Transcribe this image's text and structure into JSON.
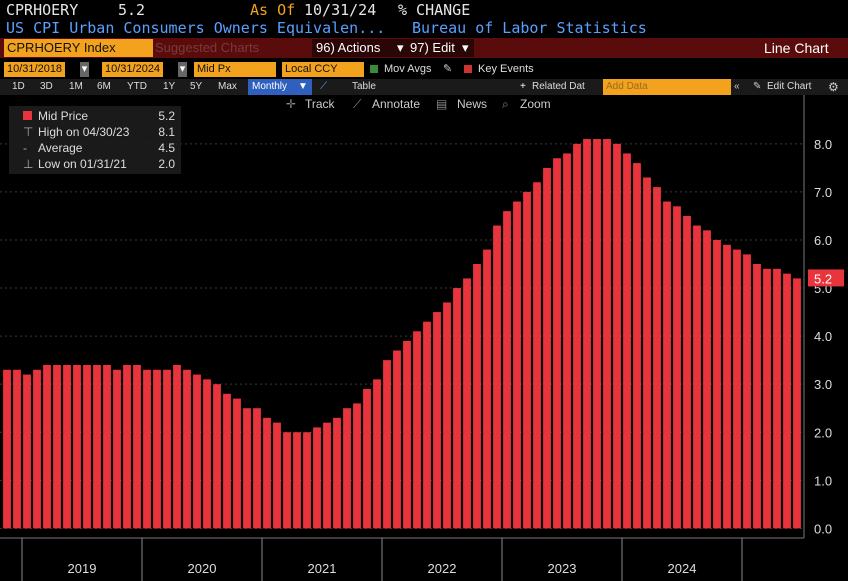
{
  "header": {
    "ticker": "CPRHOERY",
    "last_value": "5.2",
    "as_of_label": "As Of",
    "as_of_date": "10/31/24",
    "change_label": "% CHANGE",
    "description": "US CPI Urban Consumers Owners Equivalen...",
    "source": "Bureau of Labor Statistics"
  },
  "toolbar": {
    "security": "CPRHOERY Index",
    "suggested_charts": "Suggested Charts",
    "actions": "96) Actions",
    "edit": "97) Edit",
    "chart_type": "Line Chart"
  },
  "controls": {
    "start_date": "10/31/2018",
    "end_date": "10/31/2024",
    "price_field": "Mid Px",
    "currency": "Local CCY",
    "mov_avgs": "Mov Avgs",
    "key_events": "Key Events"
  },
  "periods": [
    "1D",
    "3D",
    "1M",
    "6M",
    "YTD",
    "1Y",
    "5Y",
    "Max"
  ],
  "frequency": "Monthly",
  "table_label": "Table",
  "related_data": "Related Dat",
  "add_data_placeholder": "Add Data",
  "edit_chart": "Edit Chart",
  "chart_tools": {
    "track": "Track",
    "annotate": "Annotate",
    "news": "News",
    "zoom": "Zoom"
  },
  "legend": {
    "mid_price_label": "Mid Price",
    "mid_price_value": "5.2",
    "high_label": "High on 04/30/23",
    "high_value": "8.1",
    "average_label": "Average",
    "average_value": "4.5",
    "low_label": "Low on 01/31/21",
    "low_value": "2.0"
  },
  "chart_data": {
    "type": "bar",
    "series": [
      {
        "name": "Mid Price",
        "color": "#e8343c",
        "values": [
          3.3,
          3.3,
          3.2,
          3.3,
          3.4,
          3.4,
          3.4,
          3.4,
          3.4,
          3.4,
          3.4,
          3.3,
          3.4,
          3.4,
          3.3,
          3.3,
          3.3,
          3.4,
          3.3,
          3.2,
          3.1,
          3.0,
          2.8,
          2.7,
          2.5,
          2.5,
          2.3,
          2.2,
          2.0,
          2.0,
          2.0,
          2.1,
          2.2,
          2.3,
          2.5,
          2.6,
          2.9,
          3.1,
          3.5,
          3.7,
          3.9,
          4.1,
          4.3,
          4.5,
          4.7,
          5.0,
          5.2,
          5.5,
          5.8,
          6.3,
          6.6,
          6.8,
          7.0,
          7.2,
          7.5,
          7.7,
          7.8,
          8.0,
          8.1,
          8.1,
          8.1,
          8.0,
          7.8,
          7.6,
          7.3,
          7.1,
          6.8,
          6.7,
          6.5,
          6.3,
          6.2,
          6.0,
          5.9,
          5.8,
          5.7,
          5.5,
          5.4,
          5.4,
          5.3,
          5.2
        ]
      }
    ],
    "x_labels": [
      "2019",
      "2020",
      "2021",
      "2022",
      "2023",
      "2024"
    ],
    "y_ticks": [
      0.0,
      1.0,
      2.0,
      3.0,
      4.0,
      5.0,
      6.0,
      7.0,
      8.0
    ],
    "ylim": [
      -0.2,
      8.6
    ],
    "last_value_label": "5.2",
    "grid": true,
    "legend_position": "top-left"
  }
}
